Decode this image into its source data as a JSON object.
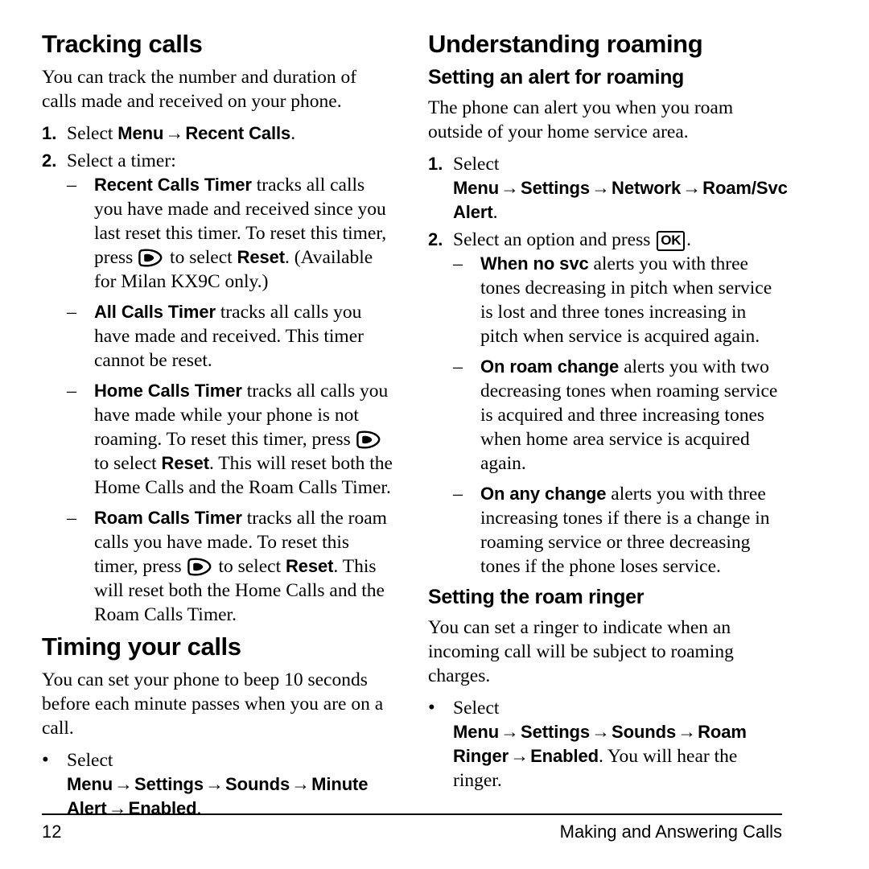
{
  "page": {
    "number": "12",
    "running_head": "Making and Answering Calls"
  },
  "icons": {
    "soft_key": "right-soft-key-icon",
    "ok_key_label": "OK"
  },
  "arrow": "→",
  "bullet_dot": "•",
  "bullet_dash": "–",
  "left_column": {
    "section1": {
      "title": "Tracking calls",
      "intro": "You can track the number and duration of calls made and received on your phone.",
      "step1": {
        "marker": "1.",
        "lead": "Select ",
        "ui1": "Menu",
        "ui2": "Recent Calls",
        "tail": "."
      },
      "step2": {
        "marker": "2.",
        "text": "Select a timer:"
      },
      "substeps": [
        {
          "term": "Recent Calls Timer",
          "part1": " tracks all calls you have made and received since you last reset this timer. To reset this timer, press ",
          "part2": " to select ",
          "term2": "Reset",
          "part3": ". (Available for Milan KX9C only.)"
        },
        {
          "term": "All Calls Timer",
          "part1": " tracks all calls you have made and received. This timer cannot be reset."
        },
        {
          "term": "Home Calls Timer",
          "part1": " tracks all calls you have made while your phone is not roaming. To reset this timer, press ",
          "part2": " to select ",
          "term2": "Reset",
          "part3": ". This will reset both the Home Calls and the Roam Calls Timer."
        },
        {
          "term": "Roam Calls Timer",
          "part1": " tracks all the roam calls you have made. To reset this timer, press ",
          "part2": " to select ",
          "term2": "Reset",
          "part3": ". This will reset both the Home Calls and the Roam Calls Timer."
        }
      ]
    },
    "section2": {
      "title": "Timing your calls",
      "intro": "You can set your phone to beep 10 seconds before each minute passes when you are on a call.",
      "bullet": {
        "lead": "Select ",
        "ui1": "Menu",
        "ui2": "Settings",
        "ui3": "Sounds",
        "ui4": "Minute Alert",
        "ui5": "Enabled",
        "tail": "."
      }
    }
  },
  "right_column": {
    "section1": {
      "title": "Understanding roaming",
      "subsection1": {
        "title": "Setting an alert for roaming",
        "intro": "The phone can alert you when you roam outside of your home service area.",
        "step1": {
          "marker": "1.",
          "lead": "Select ",
          "ui1": "Menu",
          "ui2": "Settings",
          "ui3": "Network",
          "ui4": "Roam/Svc Alert",
          "tail": "."
        },
        "step2": {
          "marker": "2.",
          "lead": "Select an option and press ",
          "tail": "."
        },
        "options": [
          {
            "term": "When no svc",
            "text": " alerts you with three tones decreasing in pitch when service is lost and three tones increasing in pitch when service is acquired again."
          },
          {
            "term": "On roam change",
            "text": " alerts you with two decreasing tones when roaming service is acquired and three increasing tones when home area service is acquired again."
          },
          {
            "term": "On any change",
            "text": " alerts you with three increasing tones if there is a change in roaming service or three decreasing tones if the phone loses service."
          }
        ]
      },
      "subsection2": {
        "title": "Setting the roam ringer",
        "intro": "You can set a ringer to indicate when an incoming call will be subject to roaming charges.",
        "bullet": {
          "lead": "Select ",
          "ui1": "Menu",
          "ui2": "Settings",
          "ui3": "Sounds",
          "ui4": "Roam Ringer",
          "ui5": "Enabled",
          "tail": ". You will hear the ringer."
        }
      }
    }
  }
}
